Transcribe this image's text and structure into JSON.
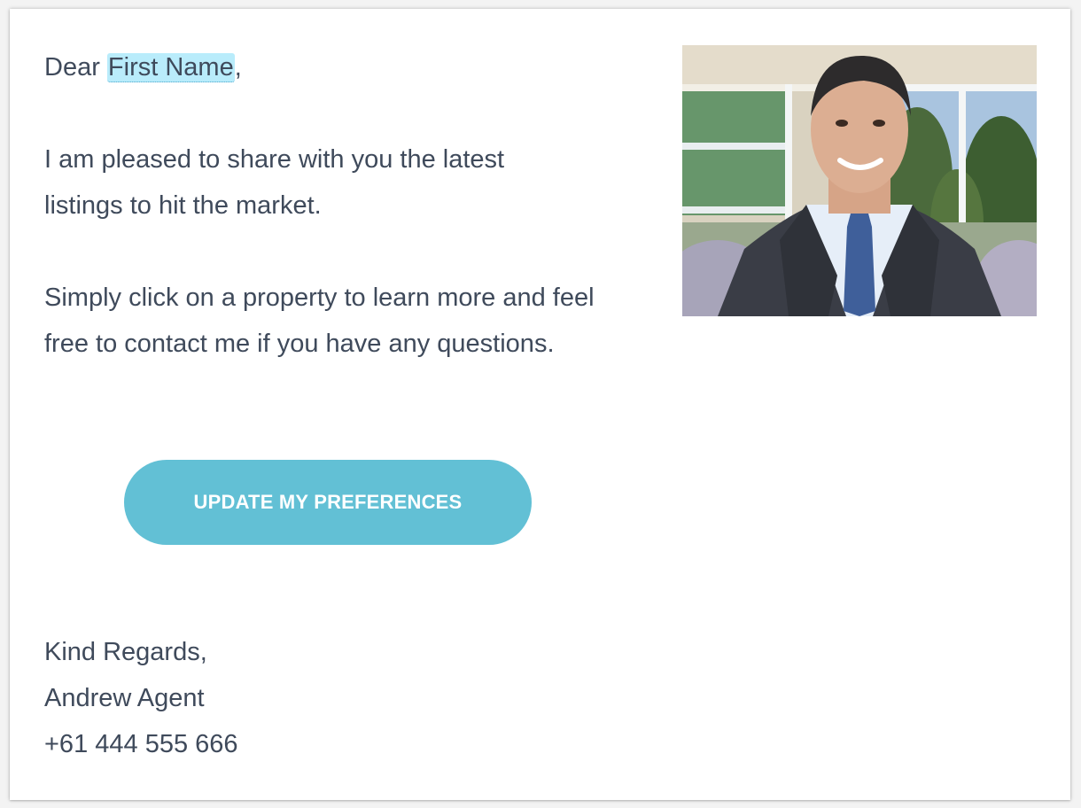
{
  "email": {
    "greeting_prefix": "Dear ",
    "merge_tag_first_name": "First Name",
    "greeting_suffix": ",",
    "paragraph_1": "I am pleased to share with you the latest listings to hit the market.",
    "paragraph_2": "Simply click on a property to learn more and feel free to contact me if you have any questions.",
    "cta_label": "UPDATE MY PREFERENCES",
    "signoff": {
      "closing": "Kind Regards,",
      "name": "Andrew Agent",
      "phone": "+61 444 555 666"
    }
  },
  "colors": {
    "text": "#3f4a5b",
    "cta_background": "#62c0d5",
    "merge_tag_highlight": "#b9ecfb"
  },
  "icons": {
    "agent_photo": "agent-portrait-photo"
  }
}
